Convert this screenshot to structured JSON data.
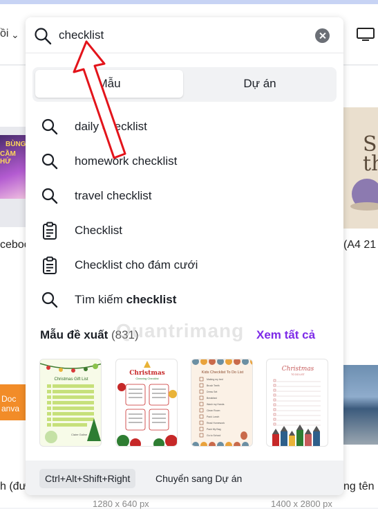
{
  "background": {
    "left_header_text": "ồi",
    "left_card_text_1": "BÙNG",
    "left_card_text_2": "CẦM HỨ",
    "right_card_text": "S\nthe",
    "left_label_1": "ceboo",
    "right_label_1": "(A4 21",
    "orange_card_line_1": "Doc",
    "orange_card_line_2": "anva",
    "left_label_2": "h (đư",
    "right_label_2": "ng tên",
    "dim_left": "1280 x 640 px",
    "dim_right": "1400 x 2800 px"
  },
  "search": {
    "value": "checklist",
    "icon": "search-icon",
    "clear_icon": "clear-icon"
  },
  "tabs": [
    {
      "label": "Mẫu",
      "active": true
    },
    {
      "label": "Dự án",
      "active": false
    }
  ],
  "suggestions": [
    {
      "icon": "search-icon",
      "label": "daily checklist"
    },
    {
      "icon": "search-icon",
      "label": "homework checklist"
    },
    {
      "icon": "search-icon",
      "label": "travel checklist"
    },
    {
      "icon": "clipboard-icon",
      "label": "Checklist"
    },
    {
      "icon": "clipboard-icon",
      "label": "Checklist cho đám cưới"
    },
    {
      "icon": "search-icon",
      "label_prefix": "Tìm kiếm ",
      "label_bold": "checklist"
    }
  ],
  "suggested_section": {
    "title": "Mẫu đề xuất",
    "count": "(831)",
    "see_all": "Xem tất cả"
  },
  "templates": [
    {
      "title": "Christmas Gift List",
      "author": "Claire Galine"
    },
    {
      "title": "Christmas",
      "subtitle": "Cleaning Checklist"
    },
    {
      "title": "Kids Checklist To Do List",
      "items": [
        "Making my bed",
        "Brush Teeth",
        "Dress Set",
        "Breakfast",
        "Wash my Hands",
        "Clean Room",
        "Pack Lunch",
        "Read Homework",
        "Pack My Bag",
        "Go to School"
      ]
    },
    {
      "title": "Christmas",
      "subtitle": "TO DO LIST"
    }
  ],
  "footer": {
    "shortcut": "Ctrl+Alt+Shift+Right",
    "label": "Chuyển sang Dự án"
  },
  "watermark": "Quantrimang",
  "colors": {
    "accent": "#7d2ae8",
    "annotation_arrow": "#e3141b"
  }
}
